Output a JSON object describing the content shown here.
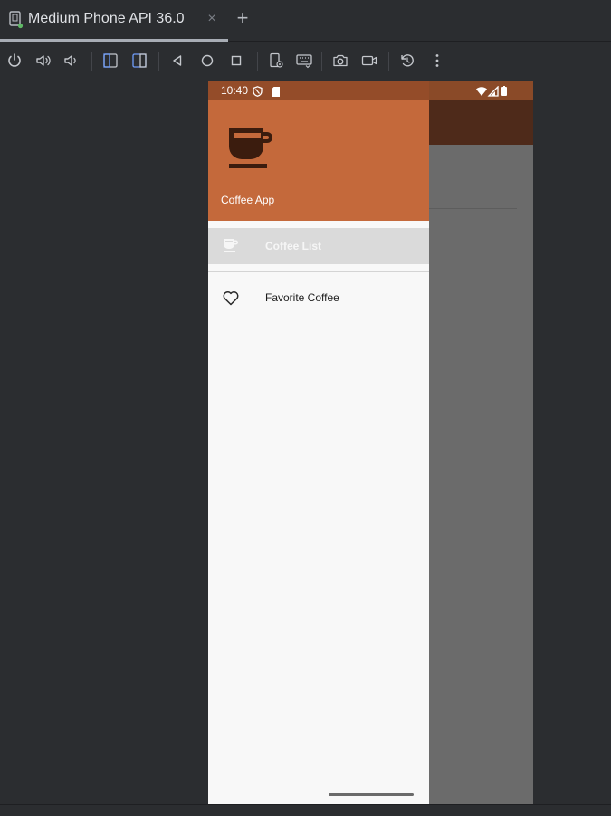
{
  "tab": {
    "title": "Medium Phone API 36.0",
    "close_glyph": "×",
    "add_glyph": "+",
    "icon": "device-icon"
  },
  "toolbar": {
    "buttons": [
      "power-icon",
      "volume-up-icon",
      "volume-down-icon",
      "rotate-left-icon",
      "rotate-right-icon",
      "back-icon",
      "home-icon",
      "overview-icon",
      "extended-controls-icon",
      "keyboard-icon",
      "camera-icon",
      "screen-record-icon",
      "snapshot-icon",
      "more-icon"
    ]
  },
  "phone": {
    "status": {
      "time": "10:40",
      "icons": [
        "shield-icon",
        "sd-card-icon",
        "wifi-icon",
        "signal-icon",
        "battery-icon"
      ]
    },
    "drawer": {
      "header_title": "Coffee App",
      "header_icon": "coffee-cup-icon",
      "items": [
        {
          "label": "Coffee List",
          "icon": "coffee-cup-icon",
          "selected": true
        },
        {
          "label": "Favorite Coffee",
          "icon": "heart-icon",
          "selected": false
        }
      ]
    }
  },
  "colors": {
    "ide_bg": "#2b2d30",
    "status_bar": "#944c29",
    "drawer_header": "#c4693b",
    "app_bar": "#4e2a1a",
    "selected_item": "#dadada",
    "drawer_bg": "#f8f8f8"
  }
}
